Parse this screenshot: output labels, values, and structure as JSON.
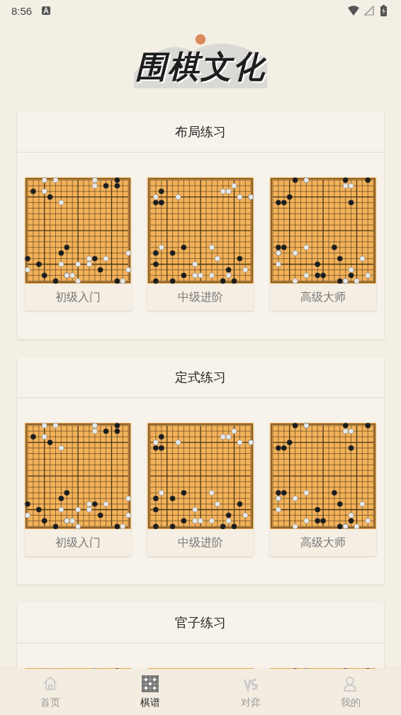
{
  "status_bar": {
    "time": "8:56"
  },
  "logo": {
    "text": "围棋文化"
  },
  "sections": [
    {
      "title": "布局练习",
      "items": [
        {
          "label": "初级入门"
        },
        {
          "label": "中级进阶"
        },
        {
          "label": "高级大师"
        }
      ]
    },
    {
      "title": "定式练习",
      "items": [
        {
          "label": "初级入门"
        },
        {
          "label": "中级进阶"
        },
        {
          "label": "高级大师"
        }
      ]
    },
    {
      "title": "官子练习",
      "items": [
        {
          "kind": "board"
        },
        {
          "kind": "board"
        },
        {
          "kind": "board"
        }
      ]
    }
  ],
  "nav": [
    {
      "label": "首页",
      "kind": "home",
      "selected": false
    },
    {
      "label": "棋谱",
      "kind": "board",
      "selected": true
    },
    {
      "label": "对弈",
      "kind": "versus",
      "selected": false
    },
    {
      "label": "我的",
      "kind": "user",
      "selected": false
    }
  ]
}
